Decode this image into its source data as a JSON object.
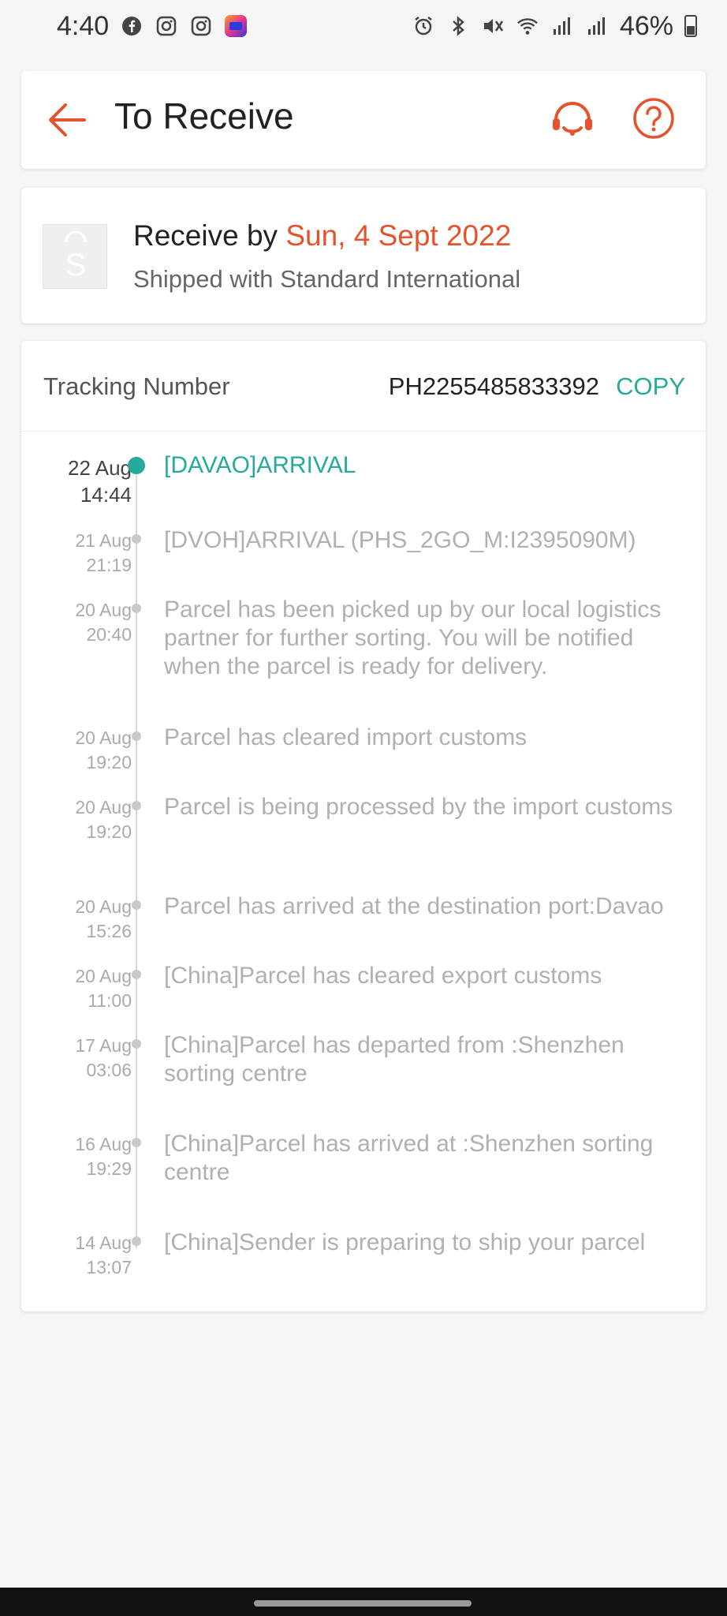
{
  "status_bar": {
    "time": "4:40",
    "battery": "46%",
    "left_icons": [
      "facebook-icon",
      "instagram-icon",
      "instagram-icon",
      "lazada-icon"
    ],
    "right_icons": [
      "alarm-icon",
      "bluetooth-icon",
      "mute-icon",
      "wifi-icon",
      "signal-icon",
      "signal-icon",
      "battery-icon"
    ]
  },
  "header": {
    "title": "To Receive",
    "back_icon": "back-arrow-icon",
    "support_icon": "headset-icon",
    "help_icon": "help-icon"
  },
  "delivery": {
    "receive_prefix": "Receive by",
    "receive_date": "Sun, 4 Sept 2022",
    "shipping_method": "Shipped with Standard International",
    "logo_letter": "S"
  },
  "tracking": {
    "label": "Tracking Number",
    "number": "PH2255485833392",
    "copy_label": "COPY"
  },
  "events": [
    {
      "date": "22 Aug",
      "time": "14:44",
      "text": "[DAVAO]ARRIVAL",
      "active": true
    },
    {
      "date": "21 Aug",
      "time": "21:19",
      "text": "[DVOH]ARRIVAL (PHS_2GO_M:I2395090M)",
      "active": false
    },
    {
      "date": "20 Aug",
      "time": "20:40",
      "text": "Parcel has been picked up by our local logistics partner for further sorting. You will be notified when the parcel is ready for delivery.",
      "active": false
    },
    {
      "date": "20 Aug",
      "time": "19:20",
      "text": "Parcel has cleared import customs",
      "active": false
    },
    {
      "date": "20 Aug",
      "time": "19:20",
      "text": "Parcel is being processed by the import customs",
      "active": false
    },
    {
      "date": "20 Aug",
      "time": "15:26",
      "text": "Parcel has arrived at the destination port:Davao",
      "active": false
    },
    {
      "date": "20 Aug",
      "time": "11:00",
      "text": "[China]Parcel has cleared export customs",
      "active": false
    },
    {
      "date": "17 Aug",
      "time": "03:06",
      "text": "[China]Parcel has departed from :Shenzhen sorting centre",
      "active": false
    },
    {
      "date": "16 Aug",
      "time": "19:29",
      "text": "[China]Parcel has arrived at :Shenzhen sorting centre",
      "active": false
    },
    {
      "date": "14 Aug",
      "time": "13:07",
      "text": "[China]Sender is preparing to ship your parcel",
      "active": false
    }
  ],
  "colors": {
    "accent_orange": "#e4532b",
    "accent_teal": "#26aa99"
  }
}
